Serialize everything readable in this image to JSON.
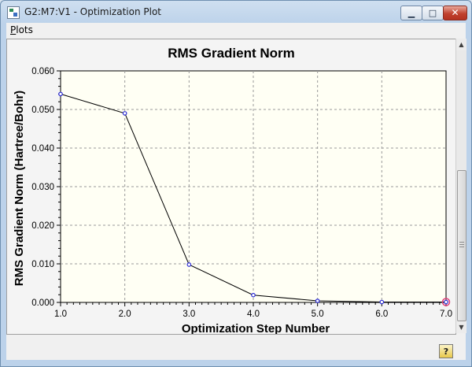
{
  "window": {
    "title": "G2:M7:V1 - Optimization Plot"
  },
  "menu": {
    "plots_label": "Plots",
    "plots_mnemonic": "P",
    "plots_rest": "lots"
  },
  "status": {
    "help_glyph": "?"
  },
  "chart_data": {
    "type": "line",
    "title": "RMS Gradient Norm",
    "xlabel": "Optimization Step Number",
    "ylabel": "RMS Gradient Norm (Hartree/Bohr)",
    "x": [
      1,
      2,
      3,
      4,
      5,
      6,
      7
    ],
    "series": [
      {
        "values": [
          0.054,
          0.049,
          0.0098,
          0.0019,
          0.0004,
          0.0001,
          0.0001
        ]
      }
    ],
    "x_ticks": [
      "1.0",
      "2.0",
      "3.0",
      "4.0",
      "5.0",
      "6.0",
      "7.0"
    ],
    "y_ticks": [
      "0.000",
      "0.010",
      "0.020",
      "0.030",
      "0.040",
      "0.050",
      "0.060"
    ],
    "xlim": [
      1,
      7
    ],
    "ylim": [
      0,
      0.06
    ],
    "grid": true,
    "line_color": "#000000",
    "marker_color": "#2b2bd6",
    "highlight_color": "#e0407a",
    "plot_background": "#fffff4"
  }
}
